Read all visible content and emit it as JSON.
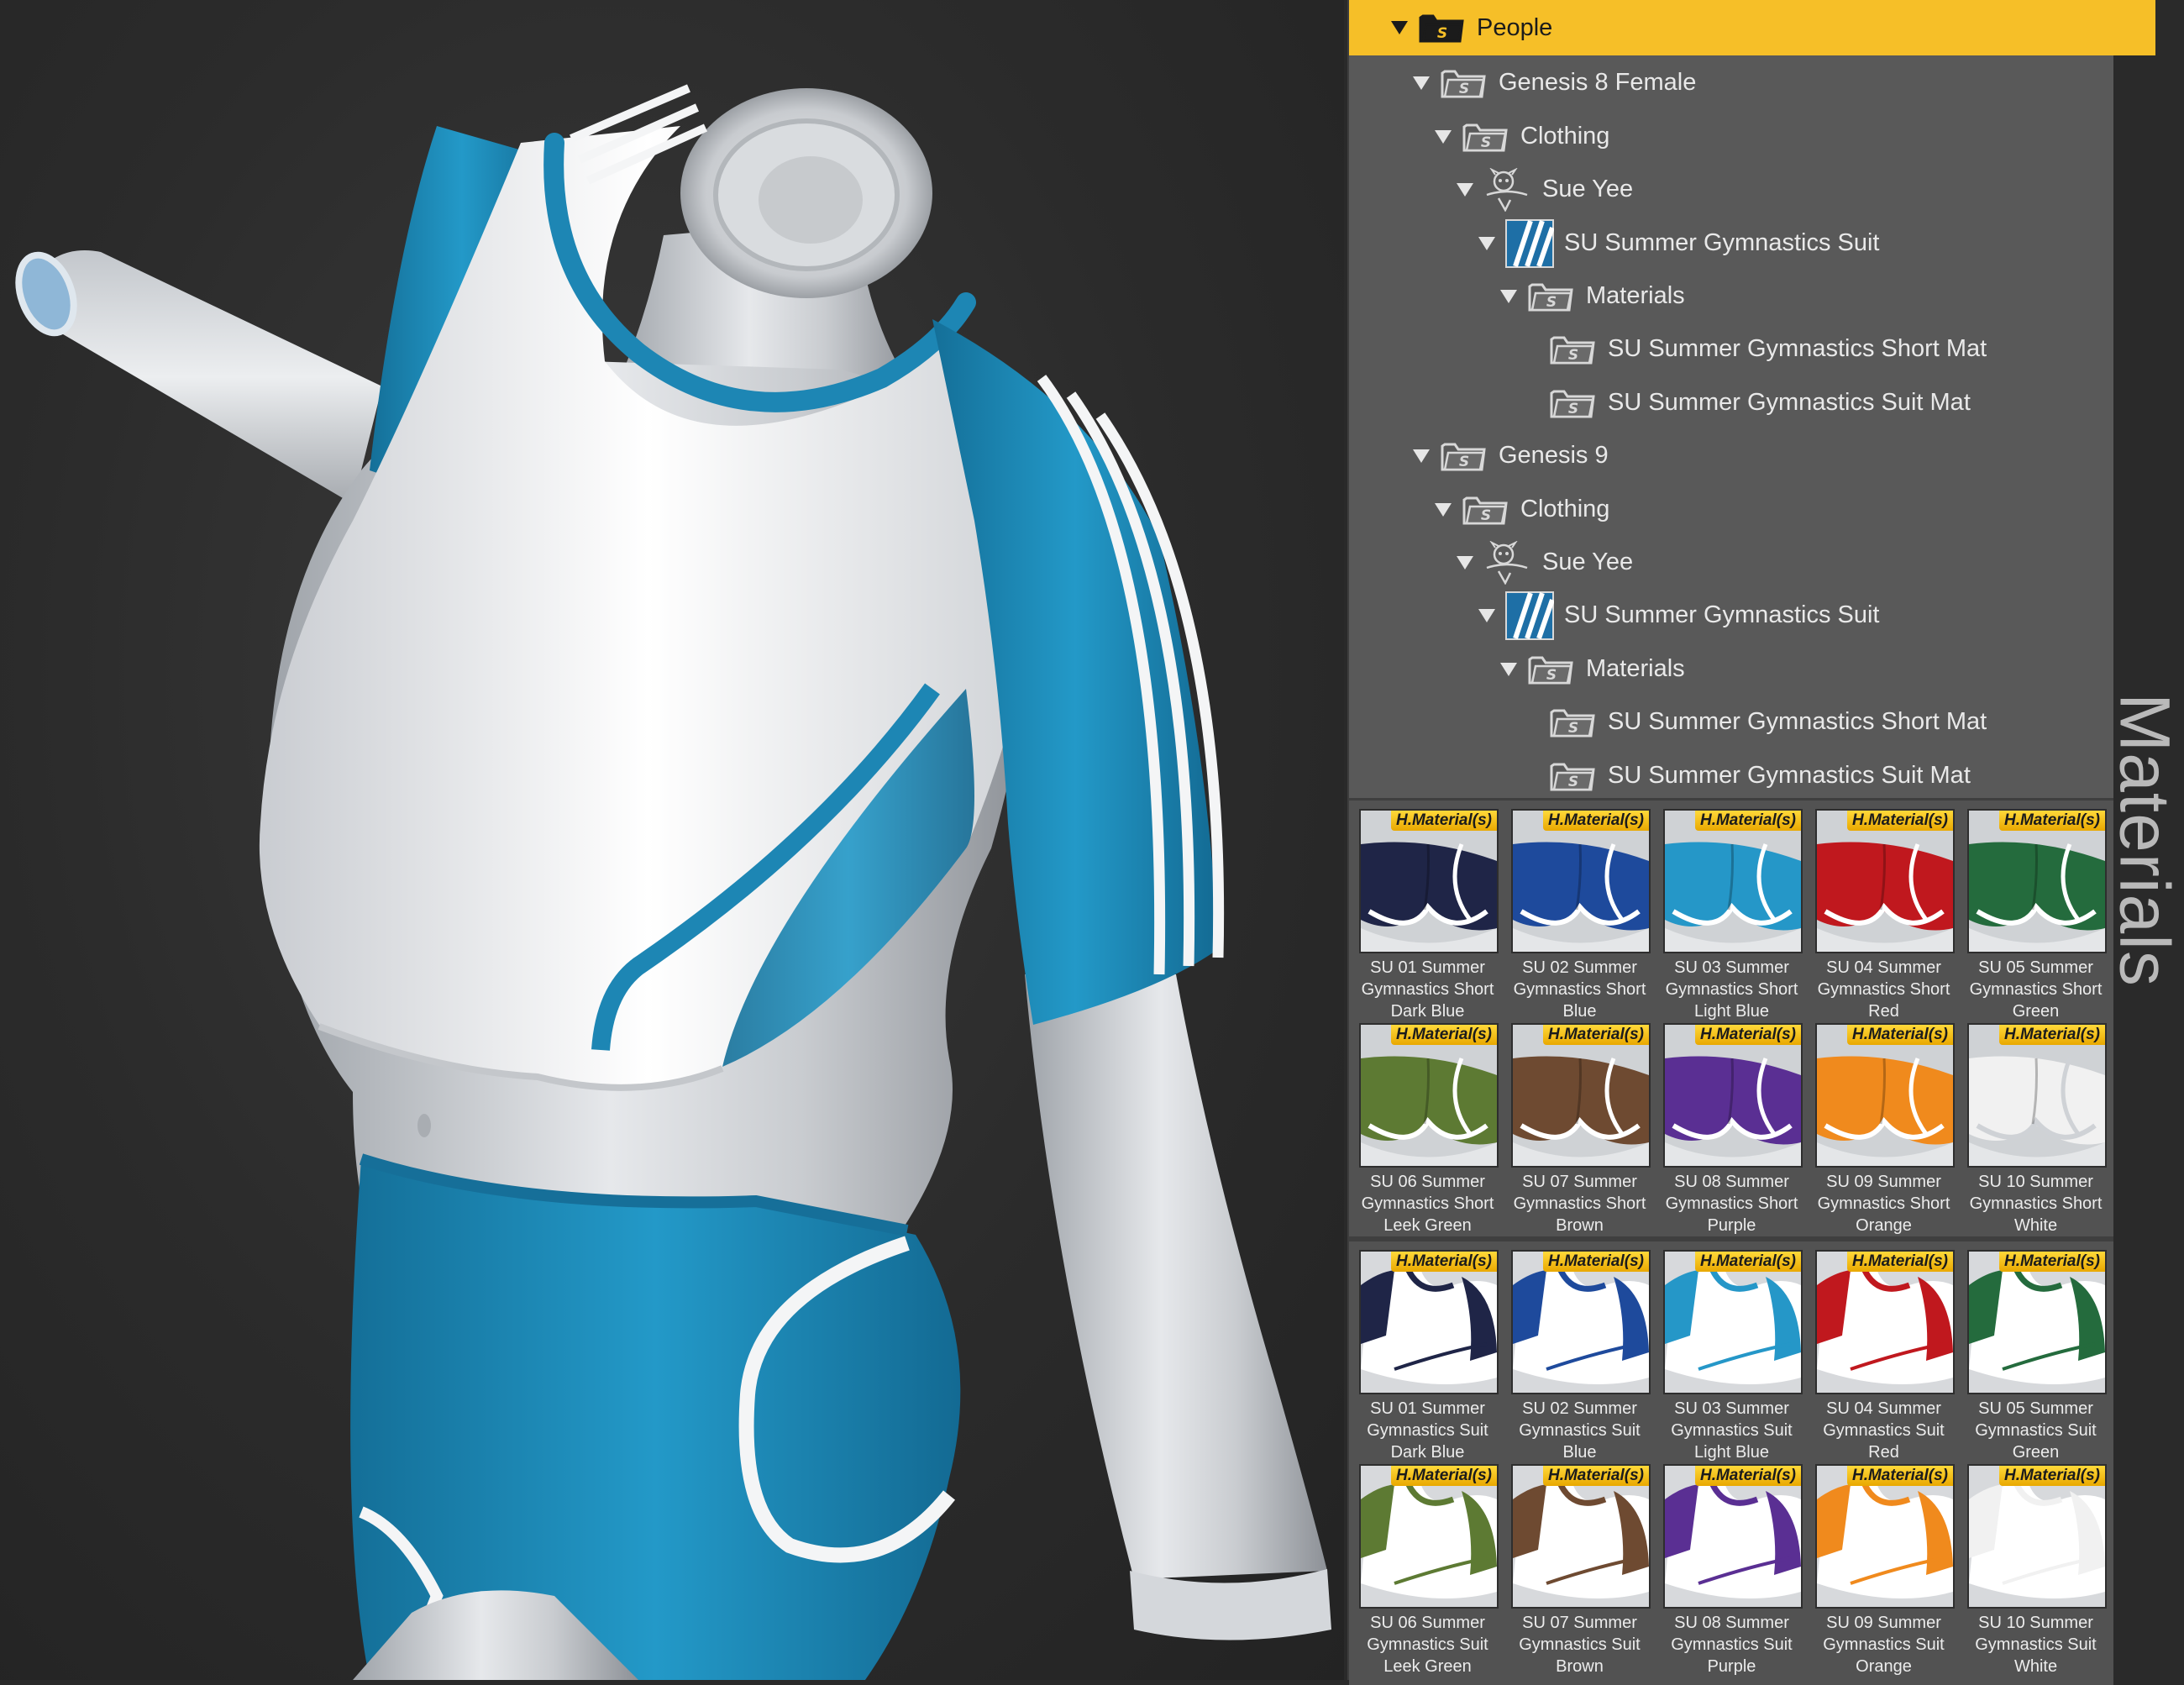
{
  "side_label": "Materials",
  "tree": [
    {
      "label": "People",
      "depth": 0,
      "icon": "folder-icon",
      "selected": true
    },
    {
      "label": "Genesis 8 Female",
      "depth": 1,
      "icon": "folder-icon"
    },
    {
      "label": "Clothing",
      "depth": 2,
      "icon": "folder-icon"
    },
    {
      "label": "Sue Yee",
      "depth": 3,
      "icon": "vendor-logo-icon"
    },
    {
      "label": "SU Summer Gymnastics Suit",
      "depth": 4,
      "icon": "product-thumbnail-icon"
    },
    {
      "label": "Materials",
      "depth": 5,
      "icon": "folder-icon"
    },
    {
      "label": "SU Summer Gymnastics Short Mat",
      "depth": 6,
      "icon": "folder-icon",
      "leaf": true
    },
    {
      "label": "SU Summer Gymnastics Suit Mat",
      "depth": 6,
      "icon": "folder-icon",
      "leaf": true
    },
    {
      "label": "Genesis 9",
      "depth": 1,
      "icon": "folder-icon"
    },
    {
      "label": "Clothing",
      "depth": 2,
      "icon": "folder-icon"
    },
    {
      "label": "Sue Yee",
      "depth": 3,
      "icon": "vendor-logo-icon"
    },
    {
      "label": "SU Summer Gymnastics Suit",
      "depth": 4,
      "icon": "product-thumbnail-icon"
    },
    {
      "label": "Materials",
      "depth": 5,
      "icon": "folder-icon"
    },
    {
      "label": "SU Summer Gymnastics Short Mat",
      "depth": 6,
      "icon": "folder-icon",
      "leaf": true
    },
    {
      "label": "SU Summer Gymnastics Suit Mat",
      "depth": 6,
      "icon": "folder-icon",
      "leaf": true
    }
  ],
  "badge_text": "H.Material(s)",
  "shorts": [
    {
      "lines": [
        "SU 01 Summer",
        "Gymnastics Short",
        "Dark Blue"
      ],
      "color": "#1f2547"
    },
    {
      "lines": [
        "SU 02 Summer",
        "Gymnastics Short",
        "Blue"
      ],
      "color": "#1e4a9c"
    },
    {
      "lines": [
        "SU 03 Summer",
        "Gymnastics Short",
        "Light Blue"
      ],
      "color": "#2597c8"
    },
    {
      "lines": [
        "SU 04 Summer",
        "Gymnastics Short",
        "Red"
      ],
      "color": "#c0181e"
    },
    {
      "lines": [
        "SU 05 Summer",
        "Gymnastics Short",
        "Green"
      ],
      "color": "#246b3d"
    },
    {
      "lines": [
        "SU 06 Summer",
        "Gymnastics Short",
        "Leek Green"
      ],
      "color": "#5d7a33"
    },
    {
      "lines": [
        "SU 07 Summer",
        "Gymnastics Short",
        "Brown"
      ],
      "color": "#6e4a31"
    },
    {
      "lines": [
        "SU 08 Summer",
        "Gymnastics Short",
        "Purple"
      ],
      "color": "#5a2f93"
    },
    {
      "lines": [
        "SU 09 Summer",
        "Gymnastics Short",
        "Orange"
      ],
      "color": "#f08a1d"
    },
    {
      "lines": [
        "SU 10 Summer",
        "Gymnastics Short",
        "White"
      ],
      "color": "#f1f1f1"
    }
  ],
  "suits": [
    {
      "lines": [
        "SU 01 Summer",
        "Gymnastics Suit",
        "Dark Blue"
      ],
      "color": "#1f2547"
    },
    {
      "lines": [
        "SU 02 Summer",
        "Gymnastics Suit",
        "Blue"
      ],
      "color": "#1e4a9c"
    },
    {
      "lines": [
        "SU 03 Summer",
        "Gymnastics Suit",
        "Light Blue"
      ],
      "color": "#2597c8"
    },
    {
      "lines": [
        "SU 04 Summer",
        "Gymnastics Suit",
        "Red"
      ],
      "color": "#c0181e"
    },
    {
      "lines": [
        "SU 05 Summer",
        "Gymnastics Suit",
        "Green"
      ],
      "color": "#246b3d"
    },
    {
      "lines": [
        "SU 06 Summer",
        "Gymnastics Suit",
        "Leek Green"
      ],
      "color": "#5d7a33"
    },
    {
      "lines": [
        "SU 07 Summer",
        "Gymnastics Suit",
        "Brown"
      ],
      "color": "#6e4a31"
    },
    {
      "lines": [
        "SU 08 Summer",
        "Gymnastics Suit",
        "Purple"
      ],
      "color": "#5a2f93"
    },
    {
      "lines": [
        "SU 09 Summer",
        "Gymnastics Suit",
        "Orange"
      ],
      "color": "#f08a1d"
    },
    {
      "lines": [
        "SU 10 Summer",
        "Gymnastics Suit",
        "White"
      ],
      "color": "#f1f1f1"
    }
  ],
  "colors": {
    "selection": "#f6bf28",
    "panel": "#595959",
    "garment_blue": "#1f8bb8",
    "garment_white": "#f4f5f6"
  }
}
